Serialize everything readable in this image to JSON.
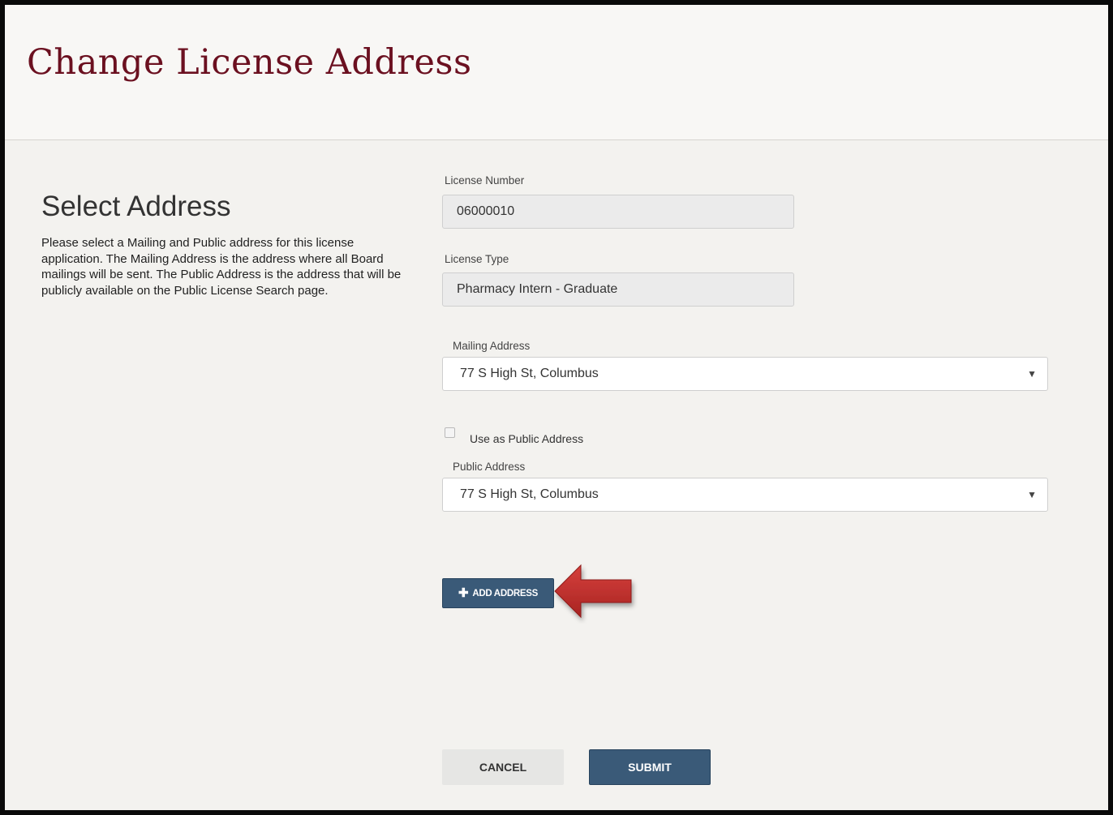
{
  "header": {
    "title": "Change License Address"
  },
  "intro": {
    "title": "Select Address",
    "description": "Please select a Mailing and Public address for this license application. The Mailing Address is the address where all Board mailings will be sent. The Public Address is the address that will be publicly available on the Public License Search page."
  },
  "form": {
    "license_number": {
      "label": "License Number",
      "value": "06000010"
    },
    "license_type": {
      "label": "License Type",
      "value": "Pharmacy Intern - Graduate"
    },
    "mailing_address": {
      "label": "Mailing Address",
      "selected": "77 S High St, Columbus",
      "icon": "caret-down-icon"
    },
    "use_as_public": {
      "label": "Use as Public Address",
      "checked": false
    },
    "public_address": {
      "label": "Public Address",
      "selected": "77 S High St, Columbus",
      "icon": "caret-down-icon"
    },
    "add_address_button": {
      "icon": "plus-icon",
      "label": "ADD ADDRESS"
    }
  },
  "actions": {
    "cancel_label": "CANCEL",
    "submit_label": "SUBMIT"
  },
  "annotation": {
    "icon": "arrow-left-icon",
    "color": "#c0302e"
  },
  "colors": {
    "title": "#6b1020",
    "primary_button": "#3a5a78",
    "background": "#f3f2ef"
  }
}
